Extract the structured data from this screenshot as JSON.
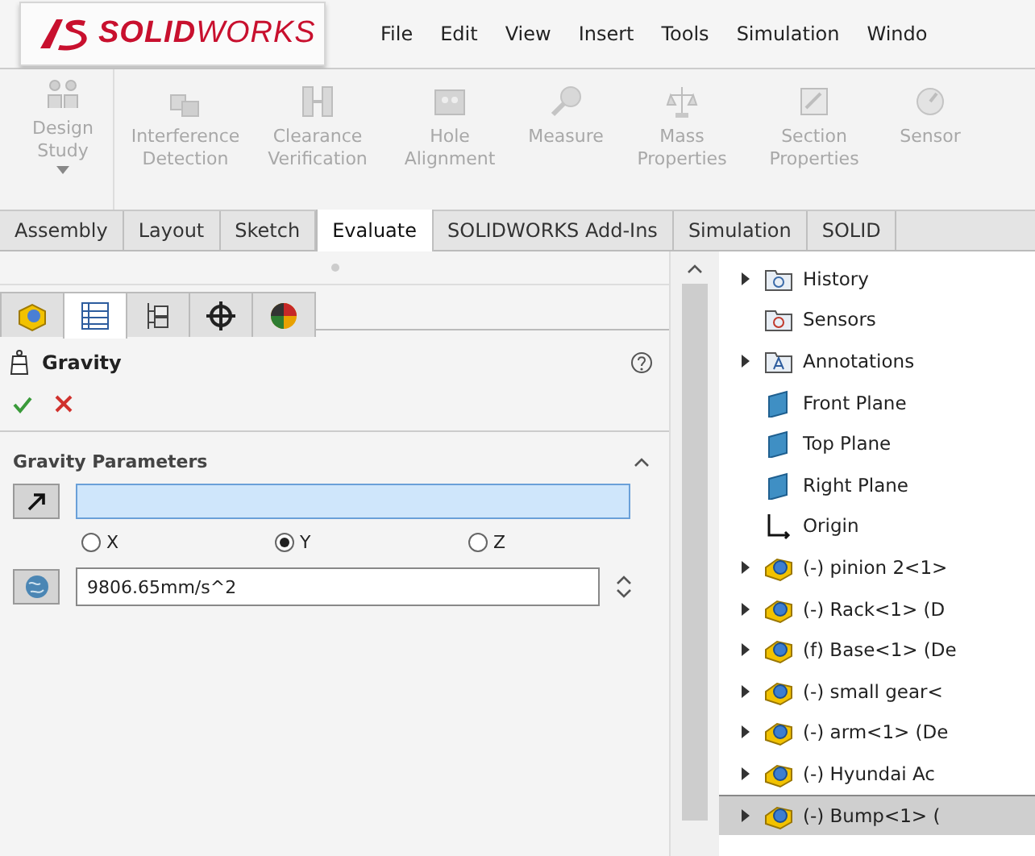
{
  "menu_bar": {
    "logo": "**SOLID**WORKS",
    "items": [
      "File",
      "Edit",
      "View",
      "Insert",
      "Tools",
      "Simulation",
      "Windo"
    ]
  },
  "ribbon": {
    "design_study": {
      "label": "Design Study",
      "disabled": true
    },
    "commands": [
      {
        "label": "Interference Detection",
        "disabled": true
      },
      {
        "label": "Clearance Verification",
        "disabled": true
      },
      {
        "label": "Hole Alignment",
        "disabled": true
      },
      {
        "label": "Measure",
        "disabled": true
      },
      {
        "label": "Mass Properties",
        "disabled": true
      },
      {
        "label": "Section Properties",
        "disabled": true
      },
      {
        "label": "Sensor",
        "disabled": true
      }
    ]
  },
  "tabs": [
    {
      "label": "Assembly",
      "selected": false
    },
    {
      "label": "Layout",
      "selected": false
    },
    {
      "label": "Sketch",
      "selected": false
    },
    {
      "label": "Evaluate",
      "selected": true
    },
    {
      "label": "SOLIDWORKS Add-Ins",
      "selected": false
    },
    {
      "label": "Simulation",
      "selected": false
    },
    {
      "label": "SOLID",
      "selected": false
    }
  ],
  "property_manager": {
    "panel_tabs": [
      {
        "selected": false
      },
      {
        "selected": true
      },
      {
        "selected": false
      },
      {
        "selected": false
      },
      {
        "selected": false
      }
    ],
    "title": "Gravity",
    "section": {
      "title": "Gravity Parameters",
      "expanded": true,
      "direction_field": {
        "active": true
      },
      "axes": [
        {
          "label": "X",
          "selected": false
        },
        {
          "label": "Y",
          "selected": true
        },
        {
          "label": "Z",
          "selected": false
        }
      ],
      "value": "9806.65mm/s^2"
    }
  },
  "feature_tree": {
    "items": [
      {
        "kind": "history",
        "label": "History",
        "expandable": true,
        "selected": false
      },
      {
        "kind": "sensors",
        "label": "Sensors",
        "expandable": false,
        "selected": false
      },
      {
        "kind": "annotations",
        "label": "Annotations",
        "expandable": true,
        "selected": false
      },
      {
        "kind": "plane",
        "label": "Front Plane",
        "expandable": false,
        "selected": false
      },
      {
        "kind": "plane",
        "label": "Top Plane",
        "expandable": false,
        "selected": false
      },
      {
        "kind": "plane",
        "label": "Right Plane",
        "expandable": false,
        "selected": false
      },
      {
        "kind": "origin",
        "label": "Origin",
        "expandable": false,
        "selected": false
      },
      {
        "kind": "part",
        "label": "(-) pinion 2<1>",
        "expandable": true,
        "selected": false
      },
      {
        "kind": "part",
        "label": "(-) Rack<1> (D",
        "expandable": true,
        "selected": false
      },
      {
        "kind": "part",
        "label": "(f) Base<1> (De",
        "expandable": true,
        "selected": false
      },
      {
        "kind": "part",
        "label": "(-) small gear<",
        "expandable": true,
        "selected": false
      },
      {
        "kind": "part",
        "label": "(-) arm<1> (De",
        "expandable": true,
        "selected": false
      },
      {
        "kind": "part",
        "label": "(-) Hyundai Ac",
        "expandable": true,
        "selected": false
      },
      {
        "kind": "part",
        "label": "(-) Bump<1> (",
        "expandable": true,
        "selected": true
      }
    ]
  }
}
